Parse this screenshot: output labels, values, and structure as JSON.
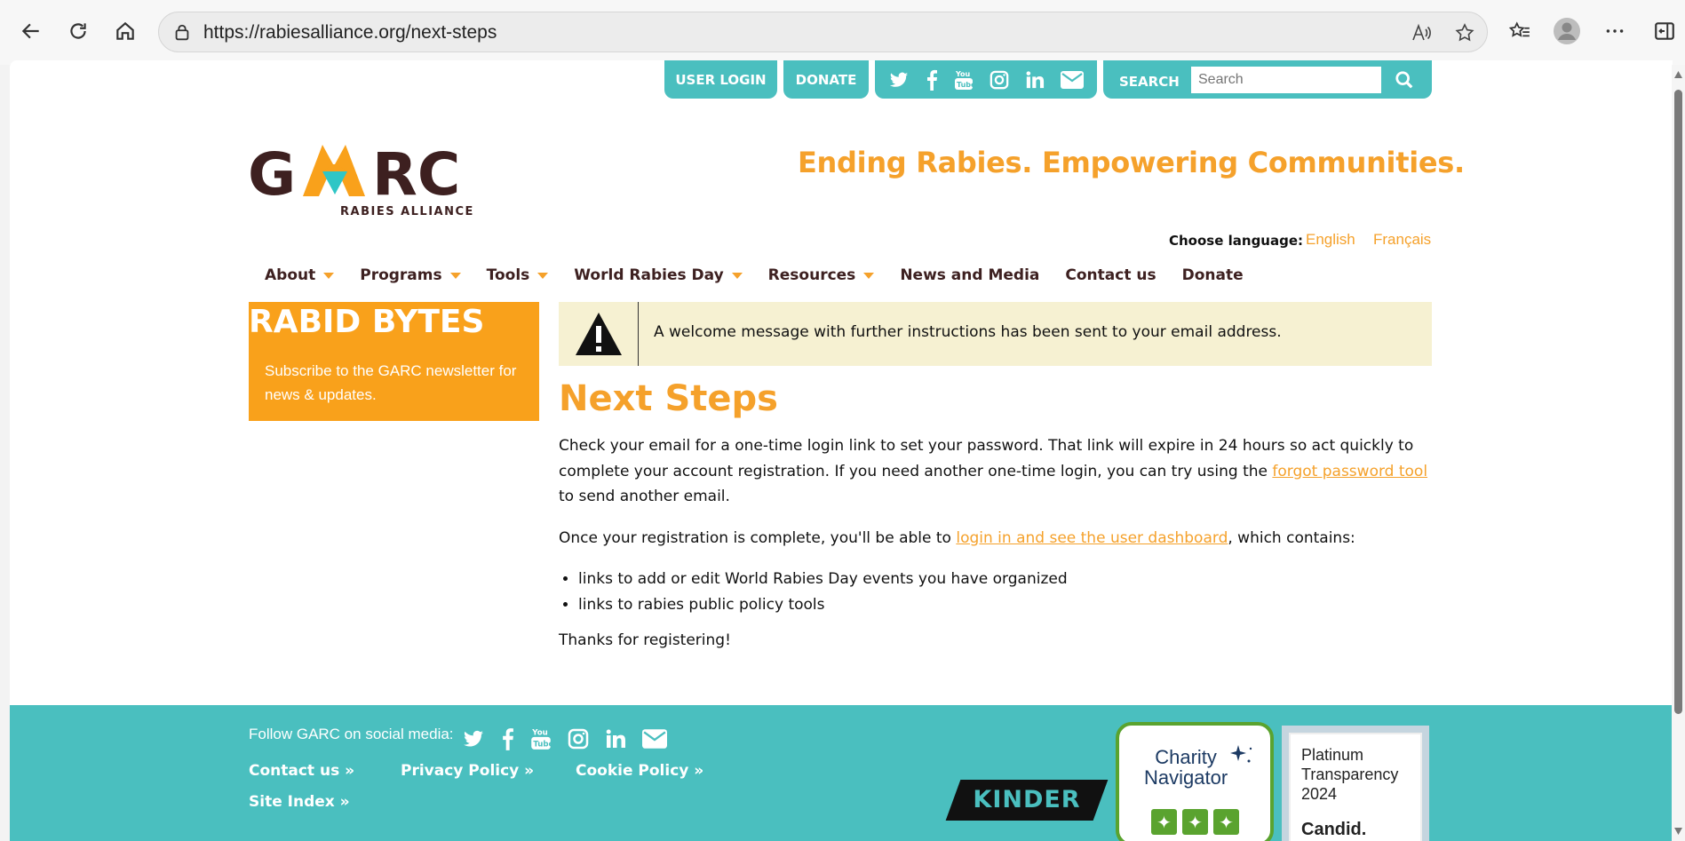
{
  "browser": {
    "url": "https://rabiesalliance.org/next-steps"
  },
  "topbar": {
    "user_login": "USER LOGIN",
    "donate": "DONATE",
    "search_label": "SEARCH",
    "search_placeholder": "Search"
  },
  "header": {
    "tagline": "Ending Rabies. Empowering Communities.",
    "logo_sub": "RABIES ALLIANCE",
    "choose_language": "Choose language:",
    "lang_english": "English",
    "lang_french": "Français"
  },
  "nav": {
    "items": [
      {
        "label": "About"
      },
      {
        "label": "Programs"
      },
      {
        "label": "Tools"
      },
      {
        "label": "World Rabies Day"
      },
      {
        "label": "Resources"
      },
      {
        "label": "News and Media"
      },
      {
        "label": "Contact us"
      },
      {
        "label": "Donate"
      }
    ]
  },
  "sidebar": {
    "title": "RABID BYTES",
    "text": "Subscribe to the GARC newsletter for news & updates."
  },
  "alert": {
    "message": "A welcome message with further instructions has been sent to your email address."
  },
  "main": {
    "title": "Next Steps",
    "p1_a": "Check your email for a one-time login link to set your password. That link will expire in 24 hours so act quickly to complete your account registration. If you need another one-time login, you can try using the ",
    "p1_link": "forgot password tool",
    "p1_b": " to send another email.",
    "p2_a": "Once your registration is complete, you'll be able to ",
    "p2_link": "login in and see the user dashboard",
    "p2_b": ", which contains:",
    "bullets": [
      "links to add or edit World Rabies Day events you have organized",
      "links to rabies public policy tools"
    ],
    "p3": "Thanks for registering!"
  },
  "footer": {
    "follow": "Follow GARC on social media:",
    "contact": "Contact us »",
    "privacy": "Privacy Policy »",
    "cookie": "Cookie Policy »",
    "site_index": "Site Index »",
    "kinder": "KINDER",
    "charity_line1": "Charity",
    "charity_line2": "Navigator",
    "candid_line1": "Platinum",
    "candid_line2": "Transparency",
    "candid_line3": "2024",
    "candid_line4": "Candid."
  },
  "colors": {
    "teal": "#4abfbf",
    "orange": "#f5a12b",
    "brown": "#3d2020",
    "alert_bg": "#f6f1d2"
  }
}
